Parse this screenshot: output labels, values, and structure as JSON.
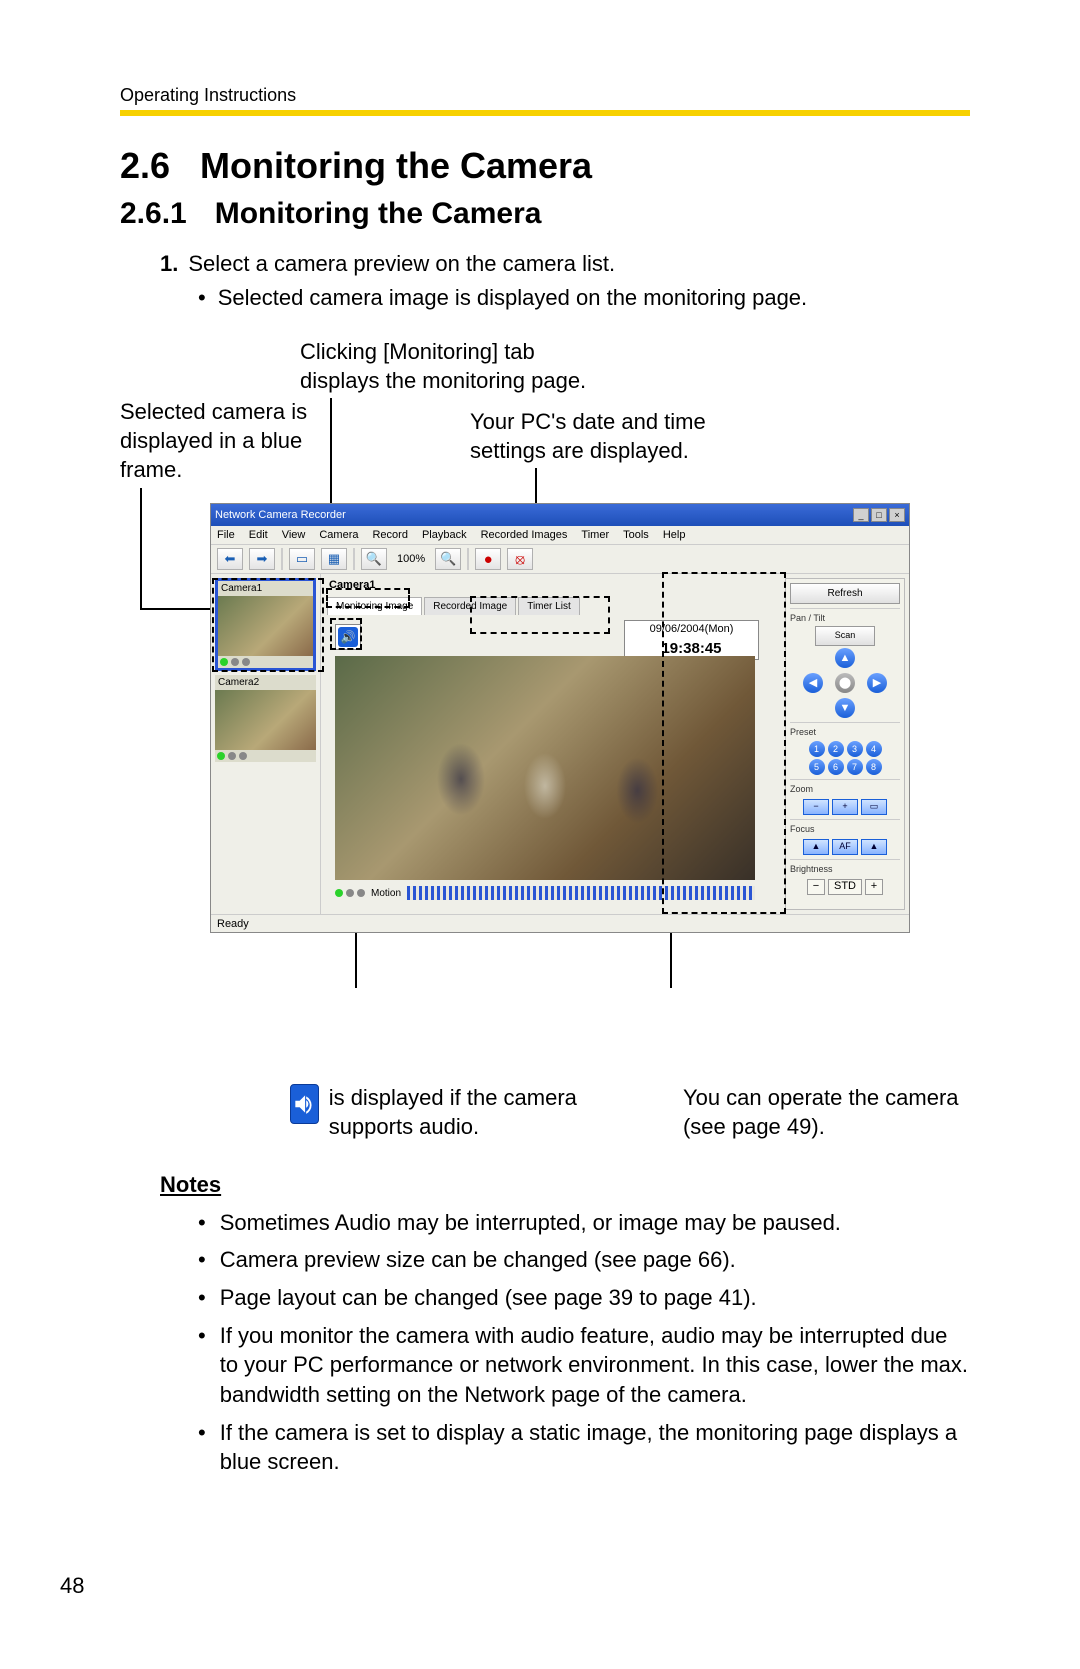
{
  "runningHead": "Operating Instructions",
  "section": {
    "num": "2.6",
    "title": "Monitoring the Camera"
  },
  "subsection": {
    "num": "2.6.1",
    "title": "Monitoring the Camera"
  },
  "step1": {
    "num": "1.",
    "text": "Select a camera preview on the camera list.",
    "sub": "Selected camera image is displayed on the monitoring page."
  },
  "callouts": {
    "selected": "Selected camera is displayed in a blue frame.",
    "tab": "Clicking [Monitoring] tab displays the monitoring page.",
    "datetime": "Your PC's date and time settings are displayed.",
    "audioPrefix": " is displayed if the camera supports audio.",
    "operate": "You can operate the camera (see page 49)."
  },
  "app": {
    "title": "Network Camera Recorder",
    "menus": [
      "File",
      "Edit",
      "View",
      "Camera",
      "Record",
      "Playback",
      "Recorded Images",
      "Timer",
      "Tools",
      "Help"
    ],
    "zoomLabel": "100%",
    "status": "Ready",
    "camList": [
      {
        "name": "Camera1",
        "selected": true
      },
      {
        "name": "Camera2",
        "selected": false
      }
    ],
    "mainPane": {
      "title": "Camera1",
      "tabs": [
        "Monitoring Image",
        "Recorded Image",
        "Timer List"
      ],
      "date": "09/06/2004(Mon)",
      "time": "19:38:45",
      "motionLabel": "Motion"
    },
    "ctrl": {
      "refresh": "Refresh",
      "pantilt": "Pan / Tilt",
      "scan": "Scan",
      "preset": "Preset",
      "presets": [
        "1",
        "2",
        "3",
        "4",
        "5",
        "6",
        "7",
        "8"
      ],
      "zoom": "Zoom",
      "focus": "Focus",
      "af": "AF",
      "brightness": "Brightness",
      "std": "STD"
    }
  },
  "notesHeading": "Notes",
  "notes": [
    "Sometimes Audio may be interrupted, or image may be paused.",
    "Camera preview size can be changed (see page 66).",
    "Page layout can be changed (see page 39 to page 41).",
    "If you monitor the camera with audio feature, audio may be interrupted due to your PC performance or network environment. In this case, lower the max. bandwidth setting on the Network page of the camera.",
    "If the camera is set to display a static image, the monitoring page displays a blue screen."
  ],
  "pageNumber": "48"
}
